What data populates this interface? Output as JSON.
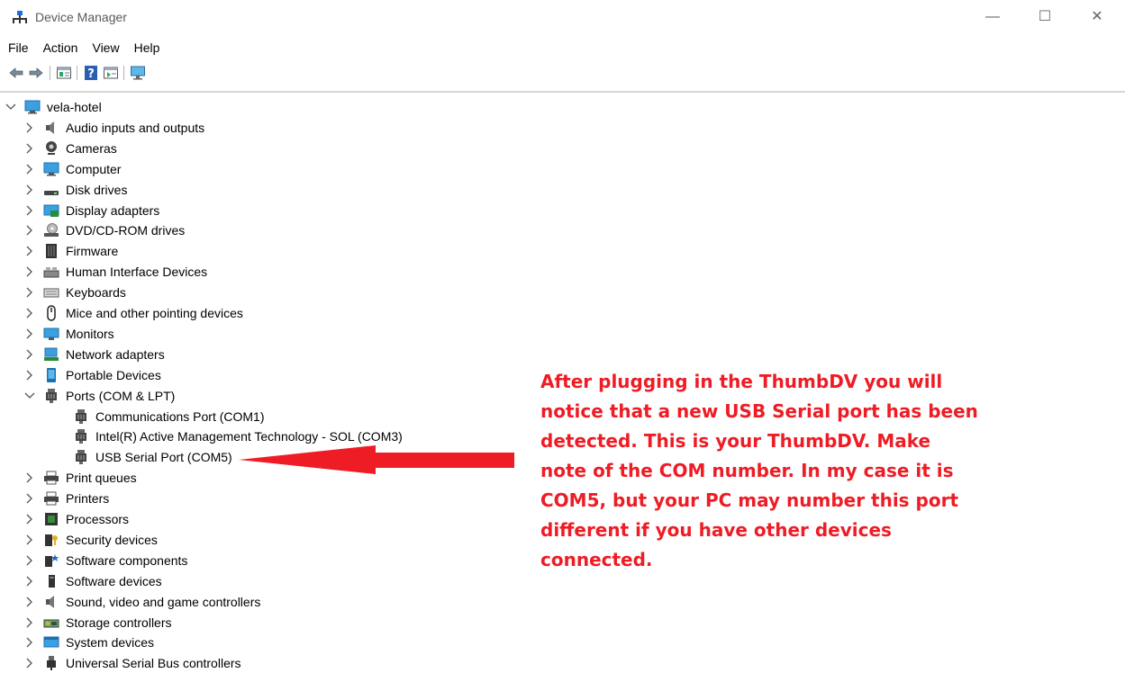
{
  "window": {
    "title": "Device Manager",
    "controls": {
      "minimize": "—",
      "maximize": "☐",
      "close": "✕"
    }
  },
  "menu": [
    "File",
    "Action",
    "View",
    "Help"
  ],
  "toolbar": [
    "back-icon",
    "forward-icon",
    "properties-icon",
    "help-icon",
    "update-driver-icon",
    "scan-hardware-icon"
  ],
  "tree": {
    "root": "vela-hotel",
    "categories": [
      {
        "label": "Audio inputs and outputs",
        "icon": "speaker-icon"
      },
      {
        "label": "Cameras",
        "icon": "camera-icon"
      },
      {
        "label": "Computer",
        "icon": "computer-icon"
      },
      {
        "label": "Disk drives",
        "icon": "disk-drive-icon"
      },
      {
        "label": "Display adapters",
        "icon": "display-adapter-icon"
      },
      {
        "label": "DVD/CD-ROM drives",
        "icon": "dvd-drive-icon"
      },
      {
        "label": "Firmware",
        "icon": "firmware-icon"
      },
      {
        "label": "Human Interface Devices",
        "icon": "hid-icon"
      },
      {
        "label": "Keyboards",
        "icon": "keyboard-icon"
      },
      {
        "label": "Mice and other pointing devices",
        "icon": "mouse-icon"
      },
      {
        "label": "Monitors",
        "icon": "monitor-icon"
      },
      {
        "label": "Network adapters",
        "icon": "network-adapter-icon"
      },
      {
        "label": "Portable Devices",
        "icon": "portable-device-icon"
      },
      {
        "label": "Ports (COM & LPT)",
        "icon": "port-icon",
        "expanded": true,
        "children": [
          {
            "label": "Communications Port (COM1)",
            "icon": "port-icon"
          },
          {
            "label": "Intel(R) Active Management Technology - SOL (COM3)",
            "icon": "port-icon"
          },
          {
            "label": "USB Serial Port (COM5)",
            "icon": "port-icon"
          }
        ]
      },
      {
        "label": "Print queues",
        "icon": "printer-icon"
      },
      {
        "label": "Printers",
        "icon": "printer-icon"
      },
      {
        "label": "Processors",
        "icon": "processor-icon"
      },
      {
        "label": "Security devices",
        "icon": "security-device-icon"
      },
      {
        "label": "Software components",
        "icon": "software-component-icon"
      },
      {
        "label": "Software devices",
        "icon": "software-device-icon"
      },
      {
        "label": "Sound, video and game controllers",
        "icon": "sound-controller-icon"
      },
      {
        "label": "Storage controllers",
        "icon": "storage-controller-icon"
      },
      {
        "label": "System devices",
        "icon": "system-devices-icon"
      },
      {
        "label": "Universal Serial Bus controllers",
        "icon": "usb-controller-icon"
      }
    ]
  },
  "annotation": {
    "text": "After plugging in the ThumbDV you will\nnotice that a new USB Serial port has been\ndetected.  This is your ThumbDV.  Make\nnote of the COM number.  In my case it is\nCOM5, but your PC may number this port\ndifferent if you have other devices\nconnected.",
    "color": "#ee1c25"
  }
}
